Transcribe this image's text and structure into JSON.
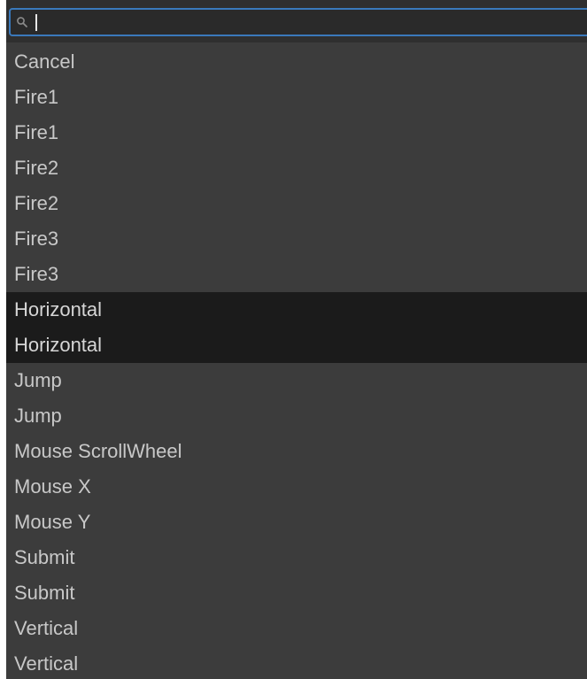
{
  "search": {
    "value": "",
    "icon": "search-icon",
    "accent_color": "#3a79bb"
  },
  "colors": {
    "panel_background": "#3c3c3c",
    "selected_background": "#1b1b1b",
    "text": "#c8c8c8"
  },
  "items": [
    {
      "label": "Cancel",
      "selected": false
    },
    {
      "label": "Fire1",
      "selected": false
    },
    {
      "label": "Fire1",
      "selected": false
    },
    {
      "label": "Fire2",
      "selected": false
    },
    {
      "label": "Fire2",
      "selected": false
    },
    {
      "label": "Fire3",
      "selected": false
    },
    {
      "label": "Fire3",
      "selected": false
    },
    {
      "label": "Horizontal",
      "selected": true
    },
    {
      "label": "Horizontal",
      "selected": true
    },
    {
      "label": "Jump",
      "selected": false
    },
    {
      "label": "Jump",
      "selected": false
    },
    {
      "label": "Mouse ScrollWheel",
      "selected": false
    },
    {
      "label": "Mouse X",
      "selected": false
    },
    {
      "label": "Mouse Y",
      "selected": false
    },
    {
      "label": "Submit",
      "selected": false
    },
    {
      "label": "Submit",
      "selected": false
    },
    {
      "label": "Vertical",
      "selected": false
    },
    {
      "label": "Vertical",
      "selected": false
    }
  ]
}
